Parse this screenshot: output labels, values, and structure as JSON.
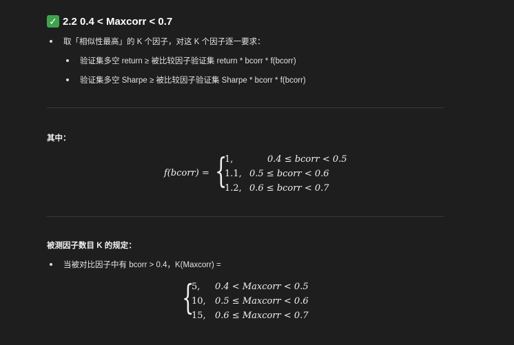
{
  "heading": {
    "check": "✓",
    "title": "2.2 0.4 < Maxcorr < 0.7"
  },
  "intro": "取「相似性最高」的 K 个因子，对这 K 个因子逐一要求：",
  "requirements": [
    "验证集多空 return ≥ 被比较因子验证集 return * bcorr * f(bcorr)",
    "验证集多空 Sharpe ≥ 被比较因子验证集 Sharpe * bcorr * f(bcorr)"
  ],
  "section1": {
    "label": "其中：",
    "lhs": "f(bcorr) =",
    "cases": [
      {
        "value": "1,",
        "condition": "0.4 ≤ bcorr < 0.5"
      },
      {
        "value": "1.1,",
        "condition": "0.5 ≤ bcorr < 0.6"
      },
      {
        "value": "1.2,",
        "condition": "0.6 ≤ bcorr < 0.7"
      }
    ]
  },
  "section2": {
    "label": "被测因子数目 K 的规定：",
    "bullet": "当被对比因子中有 bcorr > 0.4，K(Maxcorr) =",
    "cases": [
      {
        "value": "5,",
        "condition": "0.4 < Maxcorr < 0.5"
      },
      {
        "value": "10,",
        "condition": "0.5 ≤ Maxcorr < 0.6"
      },
      {
        "value": "15,",
        "condition": "0.6 ≤ Maxcorr < 0.7"
      }
    ]
  }
}
